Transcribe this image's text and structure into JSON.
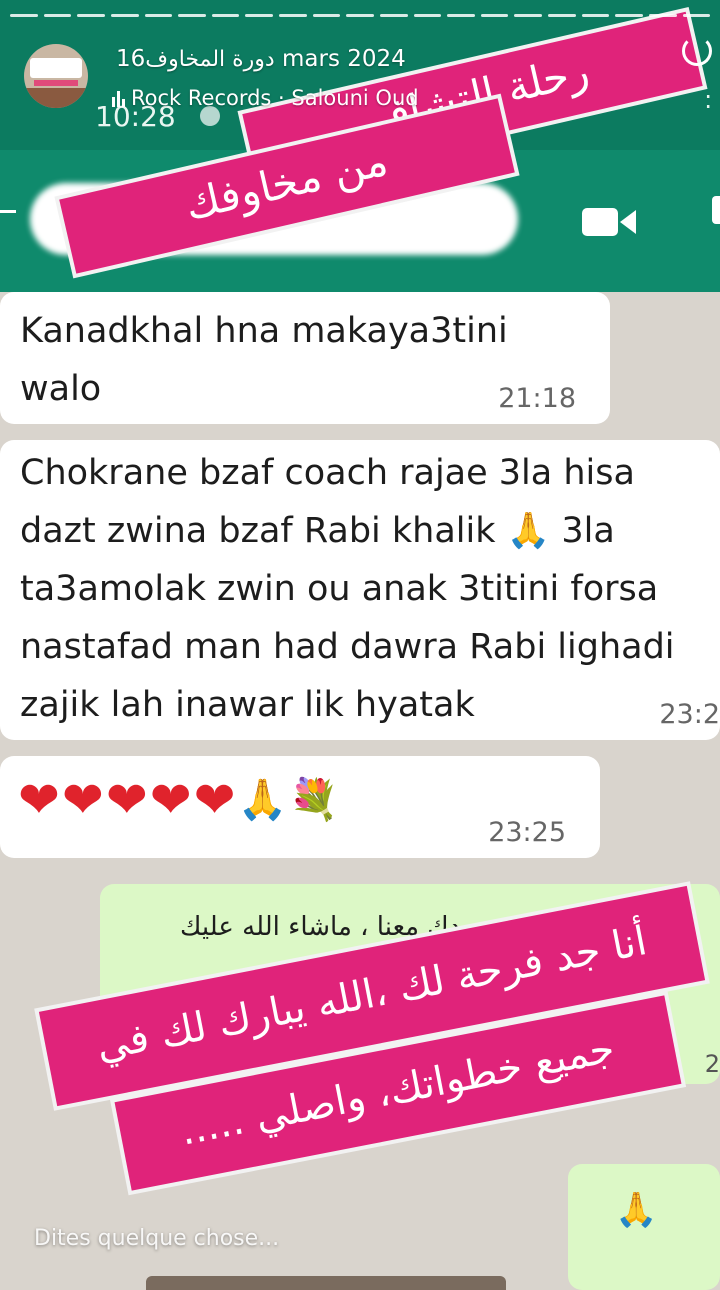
{
  "story": {
    "username": "دورة المخاوف",
    "date": "16 mars 2024",
    "music": "Rock Records · Salouni Oud",
    "input_placeholder": "Dites quelque chose..."
  },
  "whatsapp": {
    "status_time": "10:28"
  },
  "stickers": {
    "top_line1": "رحلة التشافي",
    "top_line2": "من مخاوفك",
    "bottom_line1": "أنا جد فرحة لك ،الله يبارك لك في",
    "bottom_line2": "جميع خطواتك، واصلي ....."
  },
  "messages": [
    {
      "text_l1": "Kanadkhal hna makaya3tini",
      "text_l2": "walo",
      "time": "21:18"
    },
    {
      "lines": [
        "Chokrane bzaf coach rajae 3la hisa",
        "dazt zwina bzaf Rabi khalik 🙏 3la",
        "ta3amolak zwin ou anak 3titini forsa",
        "nastafad man had dawra Rabi lighadi",
        "zajik lah inawar lik hyatak"
      ],
      "time": "23:2"
    },
    {
      "emojis": [
        "❤",
        "❤",
        "❤",
        "❤",
        "❤",
        "🙏",
        "💐"
      ],
      "time": "23:25"
    }
  ],
  "outgoing": {
    "text": "فر ... جودك معنا ، ماشاء الله عليك",
    "time": "2"
  },
  "colors": {
    "whatsapp_green": "#0f8a6c",
    "sticker_pink": "#e0237a",
    "heart_red": "#e0232c"
  }
}
